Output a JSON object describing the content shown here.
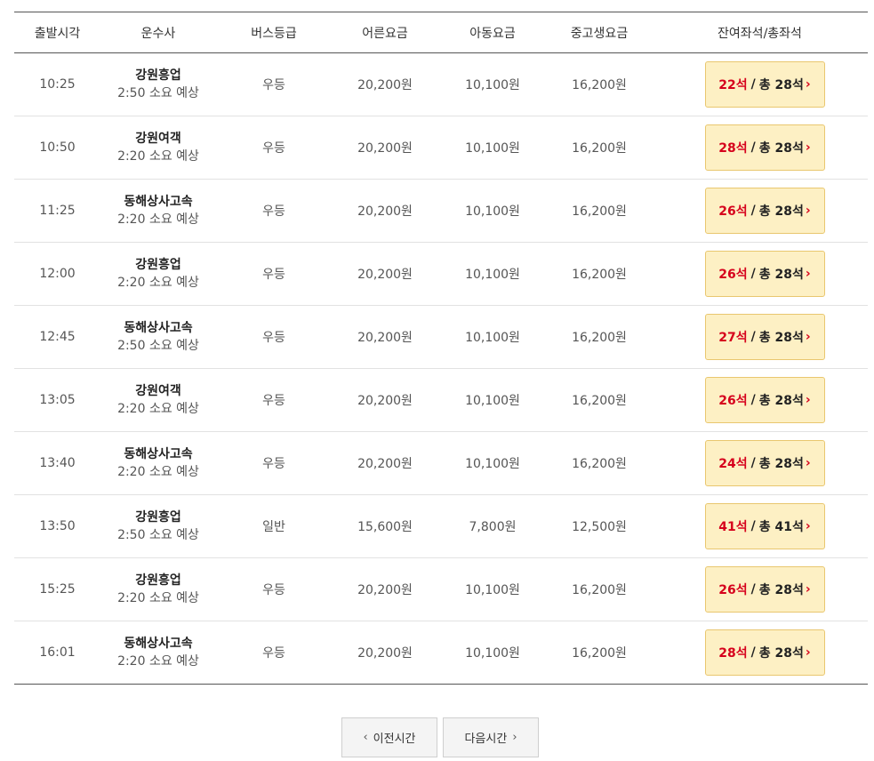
{
  "table": {
    "headers": {
      "departure": "출발시각",
      "company": "운수사",
      "grade": "버스등급",
      "adult": "어른요금",
      "child": "아동요금",
      "teen": "중고생요금",
      "seats": "잔여좌석/총좌석"
    },
    "rows": [
      {
        "time": "10:25",
        "company": "강원흥업",
        "duration": "2:50 소요 예상",
        "grade": "우등",
        "adult": "20,200원",
        "child": "10,100원",
        "teen": "16,200원",
        "remain": "22석",
        "sep": "/",
        "total": "총 28석"
      },
      {
        "time": "10:50",
        "company": "강원여객",
        "duration": "2:20 소요 예상",
        "grade": "우등",
        "adult": "20,200원",
        "child": "10,100원",
        "teen": "16,200원",
        "remain": "28석",
        "sep": "/",
        "total": "총 28석"
      },
      {
        "time": "11:25",
        "company": "동해상사고속",
        "duration": "2:20 소요 예상",
        "grade": "우등",
        "adult": "20,200원",
        "child": "10,100원",
        "teen": "16,200원",
        "remain": "26석",
        "sep": "/",
        "total": "총 28석"
      },
      {
        "time": "12:00",
        "company": "강원흥업",
        "duration": "2:20 소요 예상",
        "grade": "우등",
        "adult": "20,200원",
        "child": "10,100원",
        "teen": "16,200원",
        "remain": "26석",
        "sep": "/",
        "total": "총 28석"
      },
      {
        "time": "12:45",
        "company": "동해상사고속",
        "duration": "2:50 소요 예상",
        "grade": "우등",
        "adult": "20,200원",
        "child": "10,100원",
        "teen": "16,200원",
        "remain": "27석",
        "sep": "/",
        "total": "총 28석"
      },
      {
        "time": "13:05",
        "company": "강원여객",
        "duration": "2:20 소요 예상",
        "grade": "우등",
        "adult": "20,200원",
        "child": "10,100원",
        "teen": "16,200원",
        "remain": "26석",
        "sep": "/",
        "total": "총 28석"
      },
      {
        "time": "13:40",
        "company": "동해상사고속",
        "duration": "2:20 소요 예상",
        "grade": "우등",
        "adult": "20,200원",
        "child": "10,100원",
        "teen": "16,200원",
        "remain": "24석",
        "sep": "/",
        "total": "총 28석"
      },
      {
        "time": "13:50",
        "company": "강원흥업",
        "duration": "2:50 소요 예상",
        "grade": "일반",
        "adult": "15,600원",
        "child": "7,800원",
        "teen": "12,500원",
        "remain": "41석",
        "sep": "/",
        "total": "총 41석"
      },
      {
        "time": "15:25",
        "company": "강원흥업",
        "duration": "2:20 소요 예상",
        "grade": "우등",
        "adult": "20,200원",
        "child": "10,100원",
        "teen": "16,200원",
        "remain": "26석",
        "sep": "/",
        "total": "총 28석"
      },
      {
        "time": "16:01",
        "company": "동해상사고속",
        "duration": "2:20 소요 예상",
        "grade": "우등",
        "adult": "20,200원",
        "child": "10,100원",
        "teen": "16,200원",
        "remain": "28석",
        "sep": "/",
        "total": "총 28석"
      }
    ]
  },
  "pager": {
    "prev_label": "이전시간",
    "next_label": "다음시간",
    "prev_glyph": "‹",
    "next_glyph": "›"
  },
  "seat_arrow": "›",
  "colors": {
    "seat_button_bg": "#fdf0c4",
    "seat_button_border": "#e9c76f",
    "remain_seat": "#d6001c"
  },
  "icons": {
    "seat_arrow": "chevron-right-icon",
    "prev": "chevron-left-icon",
    "next": "chevron-right-icon"
  }
}
